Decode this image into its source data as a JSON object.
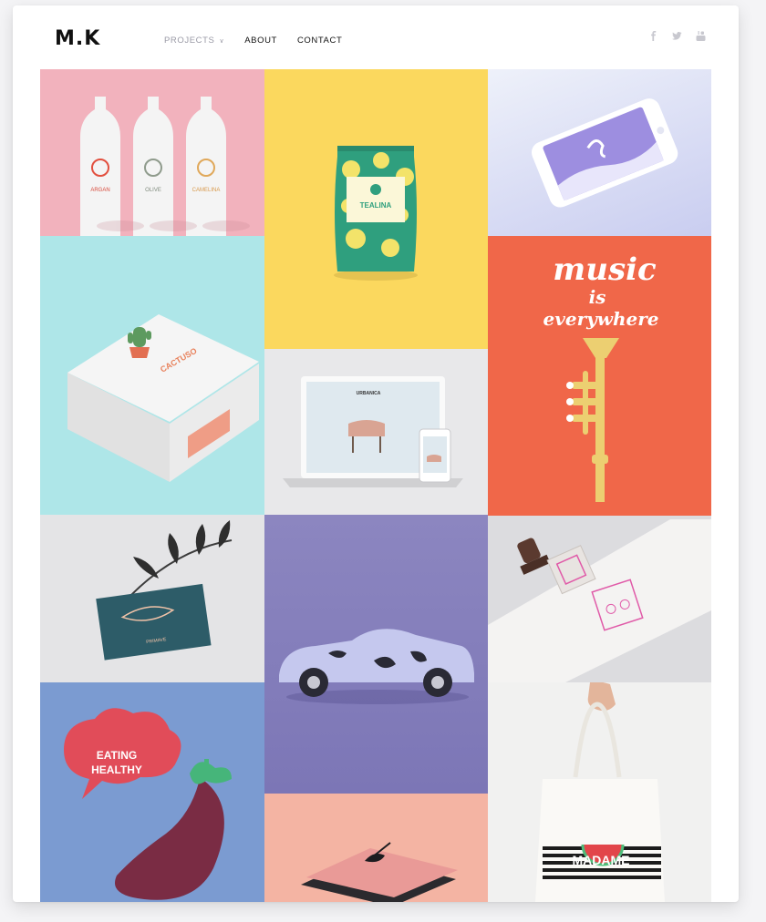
{
  "header": {
    "logo": "M.K",
    "nav": [
      {
        "label": "PROJECTS",
        "has_dropdown": true,
        "active": false
      },
      {
        "label": "ABOUT",
        "has_dropdown": false,
        "active": true
      },
      {
        "label": "CONTACT",
        "has_dropdown": false,
        "active": true
      }
    ],
    "social": [
      "facebook-icon",
      "twitter-icon",
      "youtube-icon"
    ]
  },
  "portfolio": {
    "tiles": [
      {
        "id": "bottles",
        "bottle_labels": [
          "ARGAN",
          "OLIVE",
          "CAMELINA"
        ]
      },
      {
        "id": "tealina",
        "label": "TEALINA"
      },
      {
        "id": "phone-app"
      },
      {
        "id": "cactuso",
        "label": "CACTUSO"
      },
      {
        "id": "music",
        "lines": [
          "music",
          "is",
          "everywhere"
        ]
      },
      {
        "id": "laptop",
        "label": "URBANICA"
      },
      {
        "id": "business-card",
        "label": "PRIMAVE"
      },
      {
        "id": "car"
      },
      {
        "id": "stamp"
      },
      {
        "id": "eating-healthy",
        "lines": [
          "EATING",
          "HEALTHY"
        ]
      },
      {
        "id": "tote-bag",
        "label": "MADAME"
      },
      {
        "id": "book"
      }
    ]
  },
  "colors": {
    "pink": "#f2b2bd",
    "yellow": "#fbd85e",
    "lavender": "#c9cdf0",
    "aqua": "#aee6e8",
    "coral": "#f06749",
    "purple": "#8c86c0",
    "blue": "#7b9bd1",
    "peach": "#f4b4a3"
  }
}
